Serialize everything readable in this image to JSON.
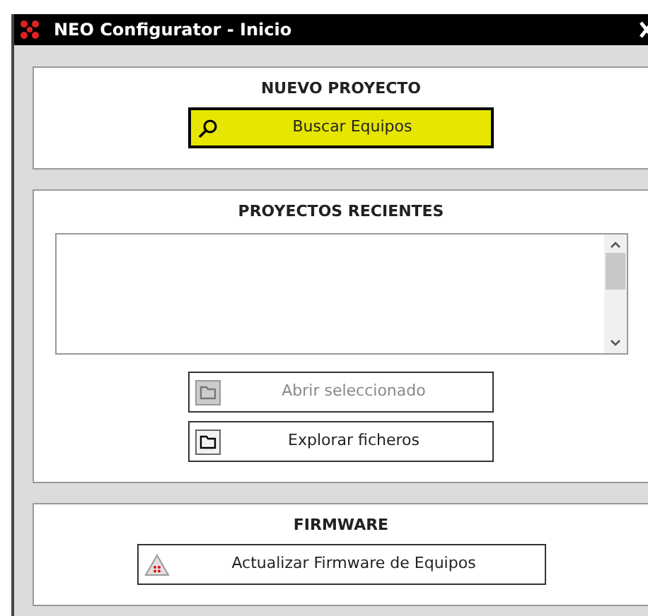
{
  "window": {
    "title": "NEO Configurator - Inicio"
  },
  "sections": [
    {
      "kind": "new",
      "heading": "NUEVO PROYECTO",
      "buttons": [
        {
          "label": "Buscar Equipos",
          "kind": "search",
          "highlighted": true,
          "disabled": false
        }
      ]
    },
    {
      "kind": "recent",
      "heading": "PROYECTOS RECIENTES",
      "buttons": [
        {
          "label": "Abrir seleccionado",
          "kind": "folder",
          "highlighted": false,
          "disabled": true
        },
        {
          "label": "Explorar ficheros",
          "kind": "folder",
          "highlighted": false,
          "disabled": false
        }
      ]
    },
    {
      "kind": "firmware",
      "heading": "FIRMWARE",
      "buttons": [
        {
          "label": "Actualizar Firmware de Equipos",
          "kind": "warning",
          "highlighted": false,
          "disabled": false
        }
      ]
    }
  ]
}
